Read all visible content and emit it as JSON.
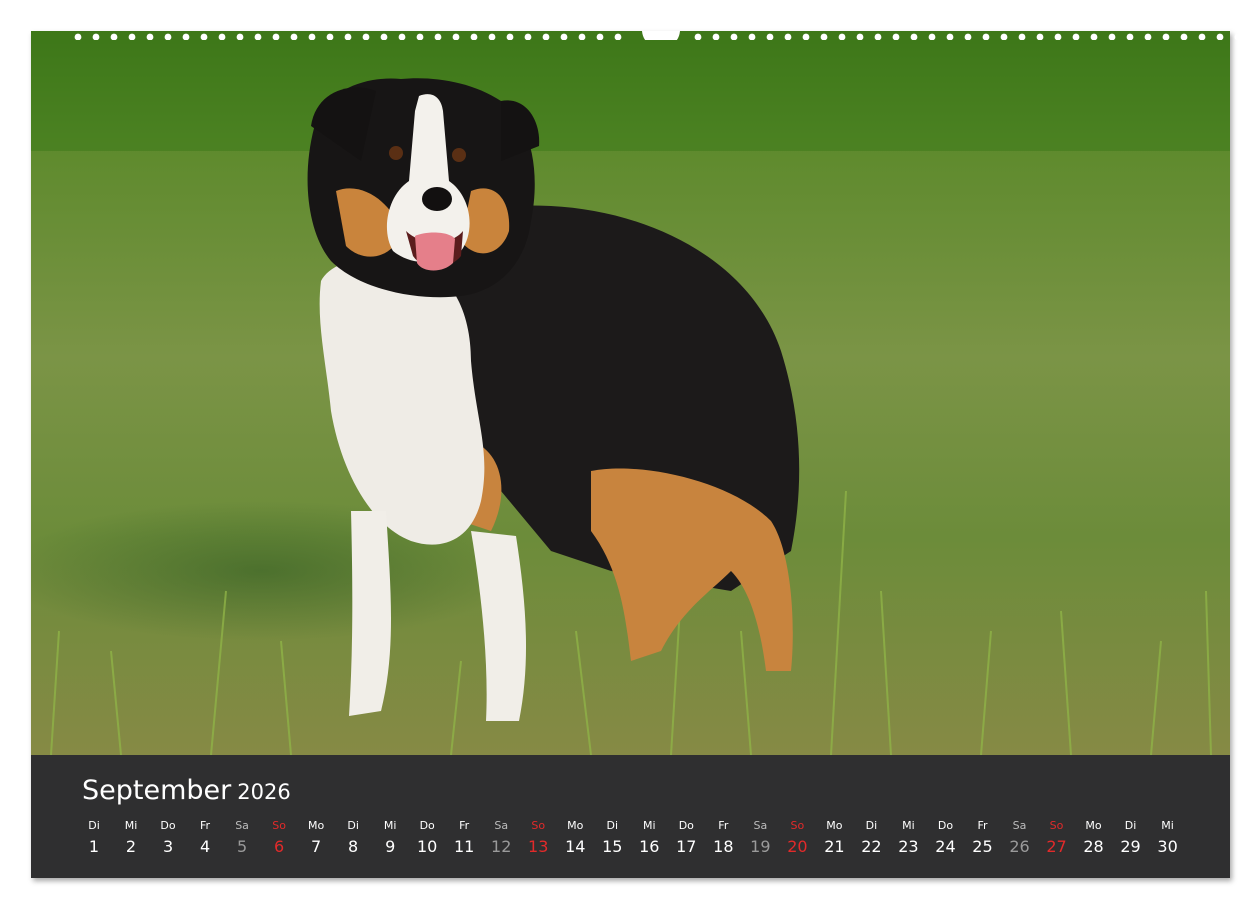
{
  "calendar": {
    "month": "September",
    "year": "2026",
    "days": [
      {
        "wd": "Di",
        "n": "1",
        "kind": "weekday"
      },
      {
        "wd": "Mi",
        "n": "2",
        "kind": "weekday"
      },
      {
        "wd": "Do",
        "n": "3",
        "kind": "weekday"
      },
      {
        "wd": "Fr",
        "n": "4",
        "kind": "weekday"
      },
      {
        "wd": "Sa",
        "n": "5",
        "kind": "sat"
      },
      {
        "wd": "So",
        "n": "6",
        "kind": "sun"
      },
      {
        "wd": "Mo",
        "n": "7",
        "kind": "weekday"
      },
      {
        "wd": "Di",
        "n": "8",
        "kind": "weekday"
      },
      {
        "wd": "Mi",
        "n": "9",
        "kind": "weekday"
      },
      {
        "wd": "Do",
        "n": "10",
        "kind": "weekday"
      },
      {
        "wd": "Fr",
        "n": "11",
        "kind": "weekday"
      },
      {
        "wd": "Sa",
        "n": "12",
        "kind": "sat"
      },
      {
        "wd": "So",
        "n": "13",
        "kind": "sun"
      },
      {
        "wd": "Mo",
        "n": "14",
        "kind": "weekday"
      },
      {
        "wd": "Di",
        "n": "15",
        "kind": "weekday"
      },
      {
        "wd": "Mi",
        "n": "16",
        "kind": "weekday"
      },
      {
        "wd": "Do",
        "n": "17",
        "kind": "weekday"
      },
      {
        "wd": "Fr",
        "n": "18",
        "kind": "weekday"
      },
      {
        "wd": "Sa",
        "n": "19",
        "kind": "sat"
      },
      {
        "wd": "So",
        "n": "20",
        "kind": "sun"
      },
      {
        "wd": "Mo",
        "n": "21",
        "kind": "weekday"
      },
      {
        "wd": "Di",
        "n": "22",
        "kind": "weekday"
      },
      {
        "wd": "Mi",
        "n": "23",
        "kind": "weekday"
      },
      {
        "wd": "Do",
        "n": "24",
        "kind": "weekday"
      },
      {
        "wd": "Fr",
        "n": "25",
        "kind": "weekday"
      },
      {
        "wd": "Sa",
        "n": "26",
        "kind": "sat"
      },
      {
        "wd": "So",
        "n": "27",
        "kind": "sun"
      },
      {
        "wd": "Mo",
        "n": "28",
        "kind": "weekday"
      },
      {
        "wd": "Di",
        "n": "29",
        "kind": "weekday"
      },
      {
        "wd": "Mi",
        "n": "30",
        "kind": "weekday"
      }
    ]
  },
  "colors": {
    "bar_background": "#2f2f30",
    "sunday_red": "#e22a2a",
    "saturday_grey": "#9a9a9a",
    "text_white": "#ffffff"
  },
  "photo": {
    "subject_icon": "dog-illustration"
  }
}
